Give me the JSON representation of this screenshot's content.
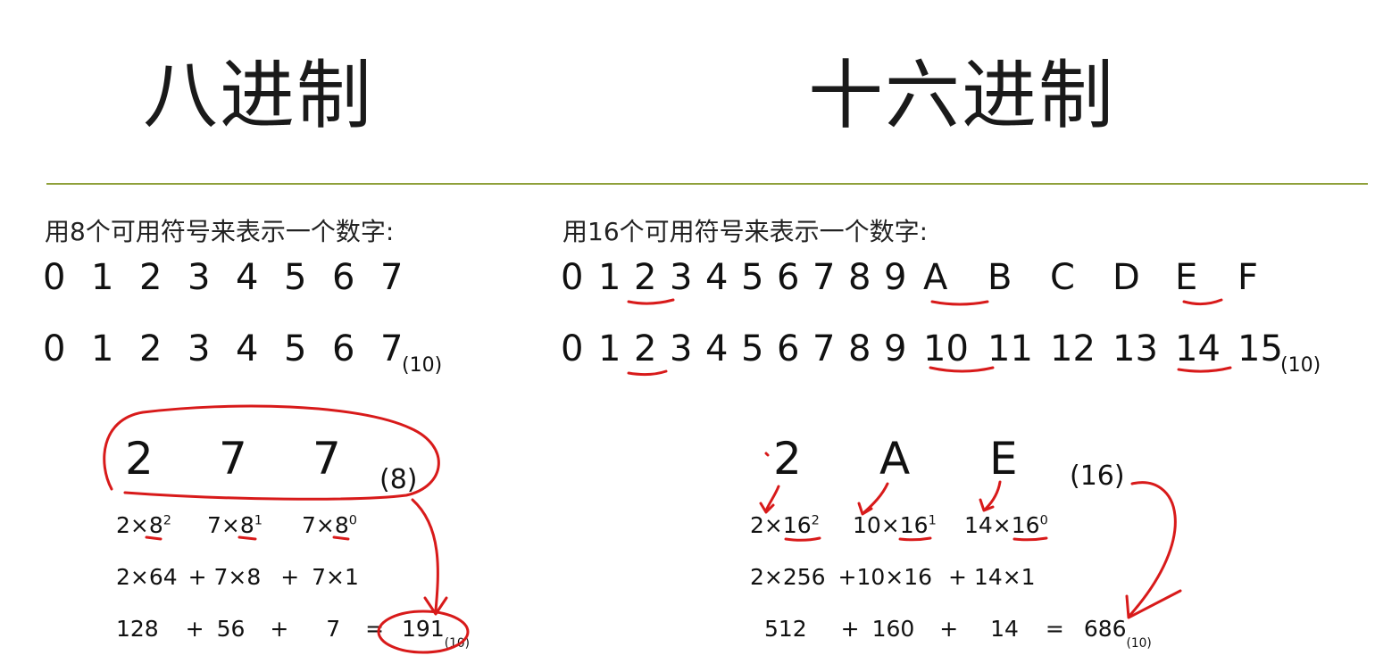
{
  "octal": {
    "title": "八进制",
    "subtitle": "用8个可用符号来表示一个数字:",
    "symbols": [
      "0",
      "1",
      "2",
      "3",
      "4",
      "5",
      "6",
      "7"
    ],
    "decimal": [
      "0",
      "1",
      "2",
      "3",
      "4",
      "5",
      "6",
      "7"
    ],
    "decimal_base": "(10)",
    "example": {
      "digits": [
        "2",
        "7",
        "7"
      ],
      "base": "(8)",
      "terms": [
        {
          "coef": "2×8",
          "exp": "2"
        },
        {
          "coef": "7×8",
          "exp": "1"
        },
        {
          "coef": "7×8",
          "exp": "0"
        }
      ],
      "expanded": [
        "2×64",
        "+ 7×8",
        "+",
        "7×1"
      ],
      "sum_parts": [
        "128",
        "+",
        "56",
        "+",
        "7",
        "="
      ],
      "result": "191",
      "result_base": "(10)"
    }
  },
  "hex": {
    "title": "十六进制",
    "subtitle": "用16个可用符号来表示一个数字:",
    "symbols": [
      "0",
      "1",
      "2",
      "3",
      "4",
      "5",
      "6",
      "7",
      "8",
      "9",
      "A",
      "B",
      "C",
      "D",
      "E",
      "F"
    ],
    "decimal": [
      "0",
      "1",
      "2",
      "3",
      "4",
      "5",
      "6",
      "7",
      "8",
      "9",
      "10",
      "11",
      "12",
      "13",
      "14",
      "15"
    ],
    "decimal_base": "(10)",
    "example": {
      "digits": [
        "2",
        "A",
        "E"
      ],
      "base": "(16)",
      "terms": [
        {
          "coef": "2×16",
          "exp": "2"
        },
        {
          "coef": "10×16",
          "exp": "1"
        },
        {
          "coef": "14×16",
          "exp": "0"
        }
      ],
      "expanded": [
        "2×256",
        "+10×16",
        "+ 14×1"
      ],
      "sum_parts": [
        "512",
        "+",
        "160",
        "+",
        "14",
        "="
      ],
      "result": "686",
      "result_base": "(10)"
    }
  },
  "annotation_color": "#d81a1a",
  "rule_color": "#8fa03a"
}
